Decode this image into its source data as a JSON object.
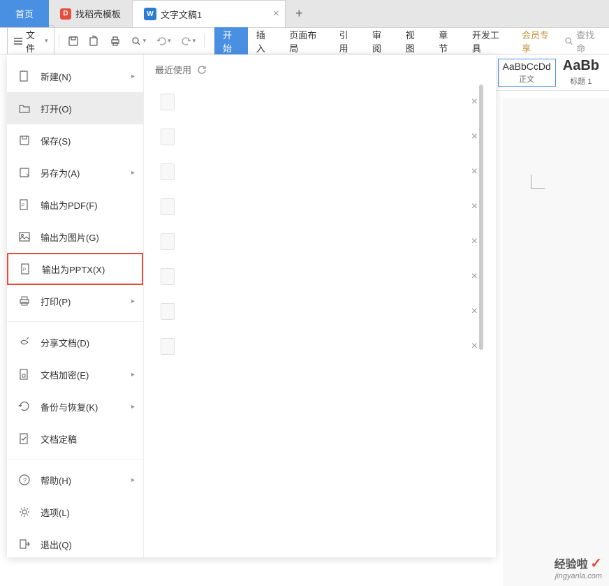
{
  "tabs": {
    "home": "首页",
    "template": "找稻壳模板",
    "doc": "文字文稿1"
  },
  "toolbar": {
    "file_label": "文件"
  },
  "ribbon": {
    "start": "开始",
    "insert": "插入",
    "layout": "页面布局",
    "reference": "引用",
    "review": "审阅",
    "view": "视图",
    "chapter": "章节",
    "dev": "开发工具",
    "vip": "会员专享"
  },
  "search": {
    "placeholder": "查找命"
  },
  "styles": {
    "normal_preview": "AaBbCcDd",
    "normal_label": "正文",
    "heading_preview": "AaBb",
    "heading_label": "标题 1"
  },
  "menu": {
    "new": "新建(N)",
    "open": "打开(O)",
    "save": "保存(S)",
    "saveas": "另存为(A)",
    "export_pdf": "输出为PDF(F)",
    "export_img": "输出为图片(G)",
    "export_pptx": "输出为PPTX(X)",
    "print": "打印(P)",
    "share": "分享文档(D)",
    "encrypt": "文档加密(E)",
    "backup": "备份与恢复(K)",
    "finalize": "文档定稿",
    "help": "帮助(H)",
    "options": "选项(L)",
    "exit": "退出(Q)"
  },
  "recent": {
    "header": "最近使用"
  },
  "watermark": {
    "brand": "经验啦",
    "url": "jingyanla.com"
  }
}
